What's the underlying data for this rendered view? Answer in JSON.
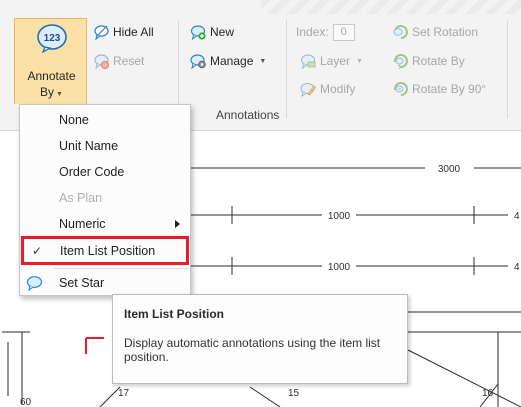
{
  "ribbon": {
    "annotate_by": {
      "icon_text": "123",
      "label_line1": "Annotate",
      "label_line2": "By"
    },
    "hide_all": "Hide All",
    "reset": "Reset",
    "new": "New",
    "manage": "Manage",
    "group_label": "Annotations",
    "index_label": "Index:",
    "index_value": "0",
    "layer": "Layer",
    "modify": "Modify",
    "set_rotation": "Set Rotation",
    "rotate_by": "Rotate By",
    "rotate_by_90": "Rotate By 90°"
  },
  "menu": {
    "items": [
      {
        "label": "None"
      },
      {
        "label": "Unit Name"
      },
      {
        "label": "Order Code"
      },
      {
        "label": "As Plan"
      },
      {
        "label": "Numeric"
      },
      {
        "label": "Item List Position",
        "checked": "✓"
      },
      {
        "label": "Set Star"
      }
    ]
  },
  "tooltip": {
    "title": "Item List Position",
    "body": "Display automatic annotations using the item list position."
  },
  "drawing": {
    "dim_3000": "3000",
    "dim_1000_a": "1000",
    "dim_1000_b": "1000",
    "edge_a": "4",
    "edge_b": "4",
    "label_17": "17",
    "label_15": "15",
    "label_16": "16",
    "label_60": "60"
  },
  "colors": {
    "highlight_border": "#e81c2a",
    "active_button_bg": "#fbe0a8",
    "icon_blue": "#2f86c8",
    "icon_green": "#2faa3a"
  },
  "icons": {
    "annotate_by": "badge-123-icon",
    "hide_all": "speech-bubble-outline-icon",
    "reset": "speech-bubble-reset-icon",
    "new": "speech-bubble-add-icon",
    "manage": "speech-bubble-gear-icon",
    "layer": "speech-bubble-layer-icon",
    "modify": "speech-bubble-pencil-icon",
    "set_rotation": "rotation-set-icon",
    "rotate_by": "rotation-icon",
    "rotate_by_90": "rotation-90-icon",
    "set_start": "speech-bubble-start-icon"
  }
}
